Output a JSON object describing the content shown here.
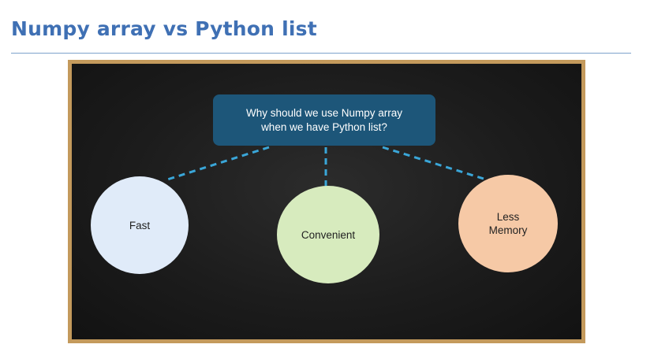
{
  "slide": {
    "title": "Numpy array vs Python list"
  },
  "diagram": {
    "question": "Why should we use Numpy array\nwhen we have Python list?",
    "nodes": [
      {
        "label": "Fast",
        "color": "#e0ebf9"
      },
      {
        "label": "Convenient",
        "color": "#d7ebbe"
      },
      {
        "label": "Less\nMemory",
        "color": "#f6c9a6"
      }
    ],
    "question_box_color": "#1d5679",
    "connector_color": "#3aa6d8",
    "board_frame_color": "#c49a5c"
  }
}
